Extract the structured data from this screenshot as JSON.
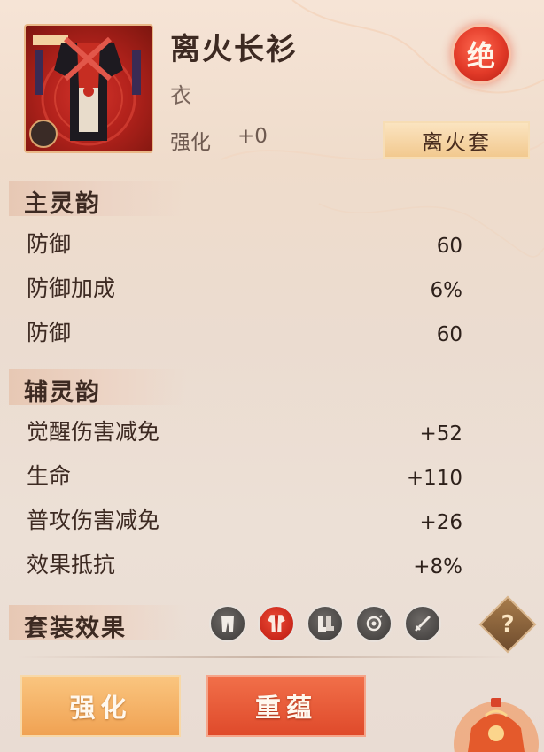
{
  "item": {
    "name": "离火长衫",
    "type": "衣",
    "enhance_label": "强化",
    "enhance_value": "+0",
    "rarity_label": "绝",
    "set_name": "离火套"
  },
  "main_stats": {
    "heading": "主灵韵",
    "rows": [
      {
        "label": "防御",
        "value": "60"
      },
      {
        "label": "防御加成",
        "value": "6%"
      },
      {
        "label": "防御",
        "value": "60"
      }
    ]
  },
  "sub_stats": {
    "heading": "辅灵韵",
    "rows": [
      {
        "label": "觉醒伤害减免",
        "value": "+52"
      },
      {
        "label": "生命",
        "value": "+110"
      },
      {
        "label": "普攻伤害减免",
        "value": "+26"
      },
      {
        "label": "效果抵抗",
        "value": "+8%"
      }
    ]
  },
  "set_effect": {
    "heading": "套装效果",
    "icons": [
      "pants-icon",
      "robe-icon",
      "boots-icon",
      "pendant-icon",
      "sword-icon"
    ],
    "active_icon": "robe-icon",
    "help_label": "?"
  },
  "buttons": {
    "enhance": "强化",
    "reroll": "重蕴"
  },
  "colors": {
    "rarity": "#e23a28",
    "enhance_button": "#f0a253",
    "reroll_button": "#df4a2b"
  }
}
